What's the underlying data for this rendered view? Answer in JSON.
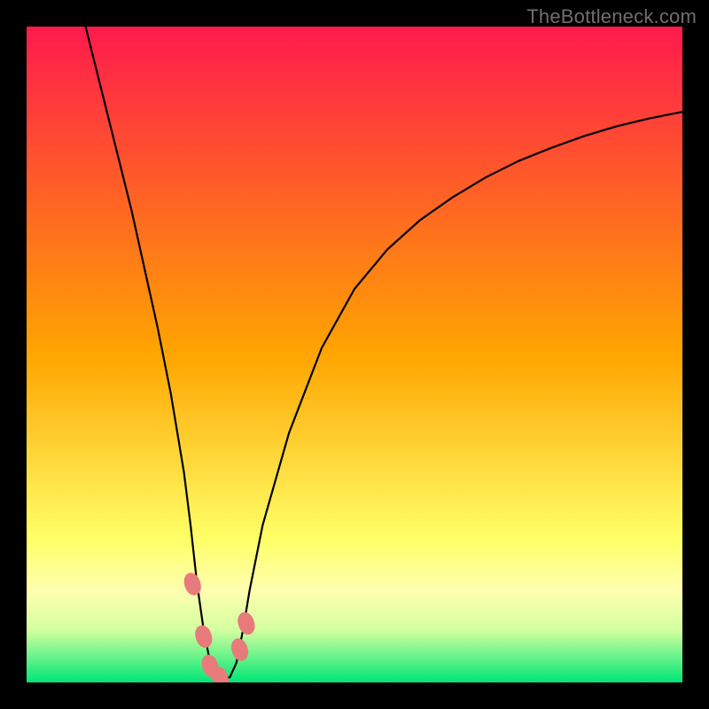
{
  "watermark": "TheBottleneck.com",
  "chart_data": {
    "type": "line",
    "title": "",
    "xlabel": "",
    "ylabel": "",
    "xlim": [
      0,
      100
    ],
    "ylim": [
      0,
      100
    ],
    "grid": false,
    "background_gradient": {
      "stops": [
        {
          "offset": 0.0,
          "color": "#ff1a4d"
        },
        {
          "offset": 0.5,
          "color": "#ffa500"
        },
        {
          "offset": 0.78,
          "color": "#ffff66"
        },
        {
          "offset": 0.86,
          "color": "#ffffb0"
        },
        {
          "offset": 0.92,
          "color": "#d4ffa0"
        },
        {
          "offset": 1.0,
          "color": "#00e676"
        }
      ]
    },
    "series": [
      {
        "name": "bottleneck-curve",
        "color": "#000000",
        "x": [
          9,
          10,
          12,
          14,
          16,
          18,
          20,
          22,
          24,
          25,
          26,
          27,
          28,
          29,
          30,
          31,
          32,
          33,
          34,
          36,
          40,
          45,
          50,
          55,
          60,
          65,
          70,
          75,
          80,
          85,
          90,
          95,
          100
        ],
        "y": [
          100,
          96,
          88,
          80,
          72,
          63,
          54,
          44,
          32,
          24,
          15,
          8,
          3,
          0.8,
          0.5,
          0.8,
          3,
          8,
          14,
          24,
          38,
          51,
          60,
          66,
          70.5,
          74,
          77,
          79.5,
          81.5,
          83.3,
          84.8,
          86,
          87
        ]
      }
    ],
    "markers": {
      "name": "highlighted-points",
      "color": "#e77b7b",
      "points": [
        {
          "x": 25.3,
          "y": 15
        },
        {
          "x": 27.0,
          "y": 7
        },
        {
          "x": 28.0,
          "y": 2.5
        },
        {
          "x": 29.5,
          "y": 0.7
        },
        {
          "x": 32.5,
          "y": 5
        },
        {
          "x": 33.5,
          "y": 9
        }
      ]
    }
  }
}
